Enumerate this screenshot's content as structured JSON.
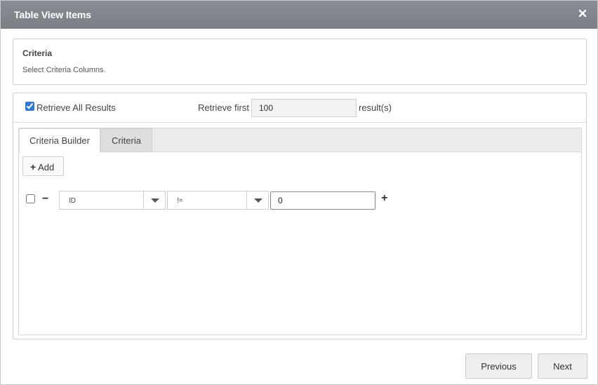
{
  "dialog": {
    "title": "Table View Items",
    "close_icon": "close-icon"
  },
  "criteria_panel": {
    "title": "Criteria",
    "subtitle": "Select Criteria Columns."
  },
  "retrieve": {
    "all_checked": true,
    "all_label": "Retrieve All Results",
    "first_label": "Retrieve first",
    "first_value": "100",
    "results_label": "result(s)"
  },
  "tabs": [
    {
      "label": "Criteria Builder",
      "active": true
    },
    {
      "label": "Criteria",
      "active": false
    }
  ],
  "builder": {
    "add_label": "Add",
    "add_icon": "plus-icon",
    "rows": [
      {
        "checked": false,
        "column": "ID",
        "operator": "!=",
        "value": "0"
      }
    ]
  },
  "footer": {
    "previous_label": "Previous",
    "next_label": "Next"
  },
  "colors": {
    "titlebar": "#7f8389",
    "checkbox_accent": "#2f7ad6"
  }
}
